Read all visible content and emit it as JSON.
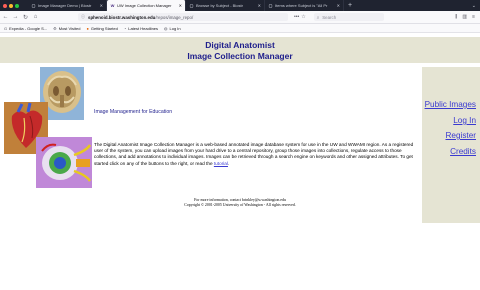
{
  "browser": {
    "tabs": [
      {
        "title": "Image Manager Demo | Biostr",
        "icon": "page-icon",
        "active": false
      },
      {
        "title": "UW Image Collection Manager",
        "icon": "w-icon",
        "active": true
      },
      {
        "title": "Browse by Subject - Biostr",
        "icon": "page-icon",
        "active": false
      },
      {
        "title": "Items where Subject is \"All Pr",
        "icon": "page-icon",
        "active": false
      }
    ],
    "new_tab_label": "+",
    "url_host": "sphenoid.biostr.washington.edu",
    "url_path": "/repos/image_repo/",
    "search_placeholder": "Search",
    "bookmarks": [
      {
        "label": "Expedia - Google S...",
        "icon": "g-icon"
      },
      {
        "label": "Most Visited",
        "icon": "gear-icon"
      },
      {
        "label": "Getting Started",
        "icon": "firefox-icon"
      },
      {
        "label": "Latest Headlines",
        "icon": "rss-icon"
      },
      {
        "label": "Log In",
        "icon": "globe-icon"
      }
    ]
  },
  "page": {
    "banner_line1": "Digital Anatomist",
    "banner_line2": "Image Collection Manager",
    "subheading": "Image Management for Education",
    "body_prefix": "The Digital Anatomist Image Collection Manager is a web-based annotated image database system for use in the UW and WWAMI region.  As a registered user of the system, you can upload images from your hard drive to a central repository, group those images into collections, regulate access to those collections, and add annotations to individual images.  Images can be retrieved through a search engine on keywords and other assigned attributes. To get started click on any of the buttons to the right, or read the ",
    "body_link": "tutorial",
    "body_suffix": ".",
    "nav_links": {
      "public_images": "Public Images",
      "log_in": "Log In",
      "register": "Register",
      "credits": "Credits"
    },
    "footer_line1": "For more information, contact brinkley@u.washington.edu",
    "footer_line2": "Copyright © 2001-2005 University of Washington - All rights reserved."
  },
  "colors": {
    "banner_bg": "#e5e4d3",
    "title_text": "#1e1e8c",
    "link": "#3a3ad0"
  }
}
